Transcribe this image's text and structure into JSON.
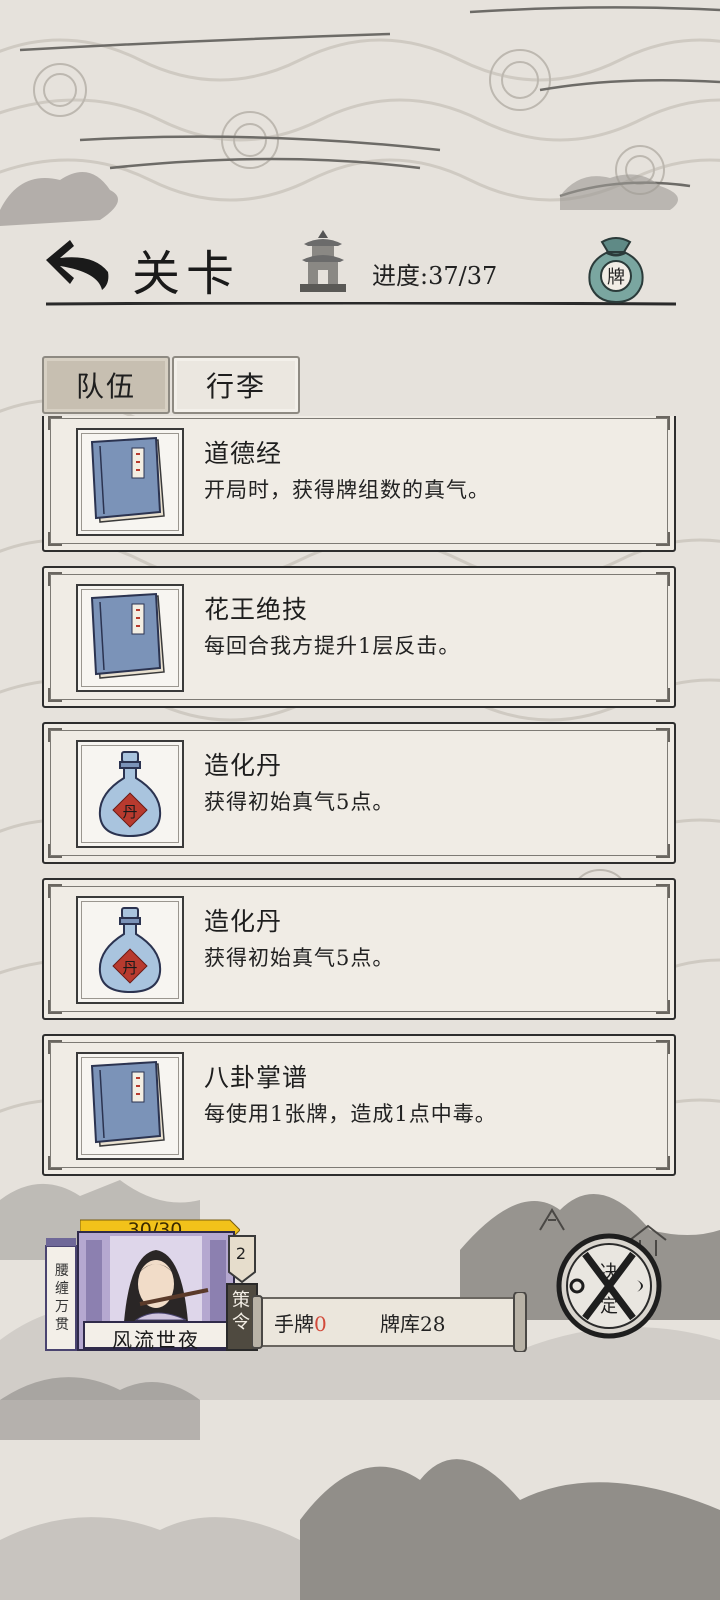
{
  "header": {
    "title": "关卡",
    "progress_label": "进度:",
    "progress_value": "37/37",
    "bag_label": "牌"
  },
  "tabs": [
    {
      "label": "队伍",
      "active": true
    },
    {
      "label": "行李",
      "active": false
    }
  ],
  "items": [
    {
      "name": "道德经",
      "desc": "开局时，获得牌组数的真气。",
      "icon": "book-icon"
    },
    {
      "name": "花王绝技",
      "desc": "每回合我方提升1层反击。",
      "icon": "book-icon"
    },
    {
      "name": "造化丹",
      "desc": "获得初始真气5点。",
      "icon": "potion-bottle-icon"
    },
    {
      "name": "造化丹",
      "desc": "获得初始真气5点。",
      "icon": "potion-bottle-icon"
    },
    {
      "name": "八卦掌谱",
      "desc": "每使用1张牌，造成1点中毒。",
      "icon": "book-icon"
    }
  ],
  "potion_label": "丹",
  "hero": {
    "hp": "30/30",
    "hp_fraction": 1.0,
    "belt_text": "腰缠万贯",
    "name": "风流世夜"
  },
  "strategy": {
    "count": "2",
    "label": "策令"
  },
  "deck": {
    "hand_label": "手牌",
    "hand_count": "0",
    "library_label": "牌库",
    "library_count": "28"
  },
  "decide_button": {
    "char1": "决",
    "char2": "定"
  },
  "colors": {
    "background": "#e6e2dc",
    "book_blue": "#7b93b8",
    "potion_blue": "#a9c4de",
    "seal_red": "#b83a2e",
    "hp_yellow": "#f2c21a",
    "hero_purple": "#b5a8d0",
    "hand_count_red": "#d24a3a"
  }
}
